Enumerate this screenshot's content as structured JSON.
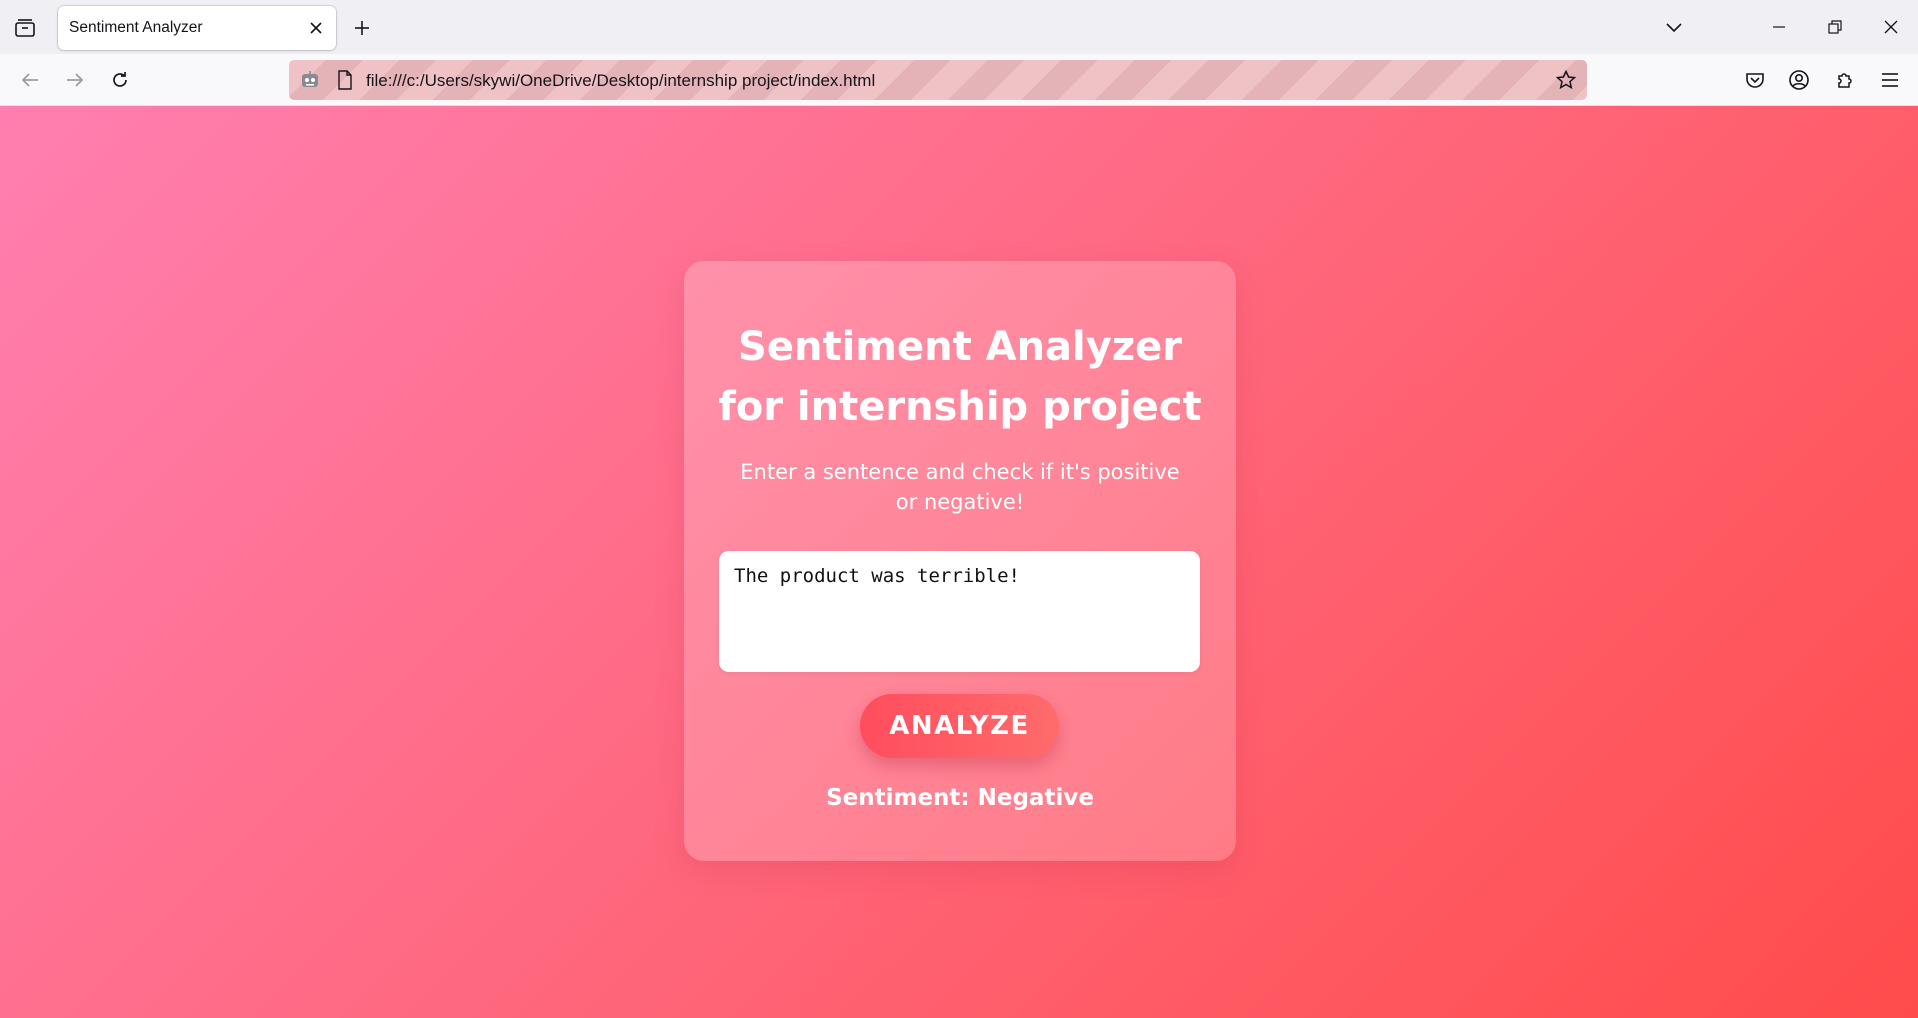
{
  "browser": {
    "tab": {
      "title": "Sentiment Analyzer"
    },
    "url": "file:///c:/Users/skywi/OneDrive/Desktop/internship project/index.html"
  },
  "page": {
    "title": "Sentiment Analyzer for internship project",
    "subtitle": "Enter a sentence and check if it's positive or negative!",
    "input_value": "The product was terrible!",
    "button_label": "ANALYZE",
    "result": "Sentiment: Negative"
  },
  "colors": {
    "gradient_start": "#ff7fb0",
    "gradient_end": "#ff4b4b",
    "button": "#ff4d5e"
  },
  "icons": [
    "tab-list-icon",
    "close-icon",
    "plus-icon",
    "chevron-down-icon",
    "minimize-icon",
    "restore-icon",
    "window-close-icon",
    "back-arrow-icon",
    "forward-arrow-icon",
    "reload-icon",
    "robot-icon",
    "page-icon",
    "star-icon",
    "pocket-icon",
    "account-icon",
    "extensions-icon",
    "hamburger-menu-icon"
  ]
}
